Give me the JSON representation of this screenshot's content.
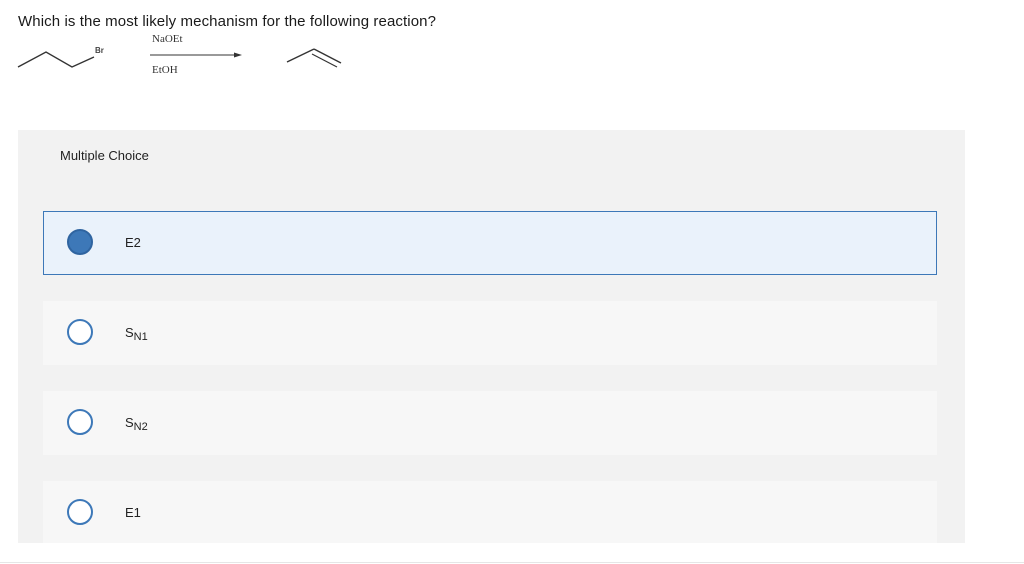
{
  "question": {
    "text": "Which is the most likely mechanism for the following reaction?"
  },
  "reaction": {
    "reagent_above": "NaOEt",
    "reagent_below": "EtOH",
    "leaving_group": "Br"
  },
  "multiple_choice": {
    "header": "Multiple Choice",
    "selected_index": 0,
    "choices": [
      {
        "main": "E2",
        "sub": ""
      },
      {
        "main": "S",
        "sub": "N1"
      },
      {
        "main": "S",
        "sub": "N2"
      },
      {
        "main": "E1",
        "sub": ""
      }
    ]
  },
  "colors": {
    "accent": "#3d78b8",
    "selected_bg": "#eaf2fb",
    "panel_bg": "#f2f2f2"
  }
}
